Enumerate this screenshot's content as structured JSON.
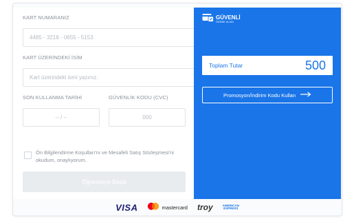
{
  "form": {
    "card_number_label": "KART NUMARANIZ",
    "card_number_placeholder": "4485 - 3218 - 0655 - 5153",
    "name_label": "KART ÜZERİNDEKİ İSİM",
    "name_placeholder": "Kart üzerindeki ismi yazınız.",
    "expiry_label": "SON KULLANMA TARİHİ",
    "expiry_placeholder": "-- / --",
    "cvc_label": "GÜVENLİK KODU (CVC)",
    "cvc_placeholder": "000",
    "consent_text": "Ön Bilgilendirme Koşulları'nı ve Mesafeli Satış Sözleşmesi'ni okudum, onaylıyorum.",
    "submit_label": "Öğrenmeye Başla"
  },
  "summary": {
    "brand_title": "GÜVENLİ",
    "brand_subtitle": "ÖDEME ALANI",
    "total_label": "Toplam Tutar",
    "total_amount": "500",
    "promo_label": "Promosyon/İndirim Kodu Kullan"
  },
  "footer": {
    "visa": "VISA",
    "mastercard": "mastercard",
    "troy": "troy",
    "amex_line1": "AMERICAN",
    "amex_line2": "EXPRESS"
  },
  "colors": {
    "accent": "#1a75e8",
    "button_disabled": "#e9ecef"
  },
  "icons": [
    "secure-card-icon",
    "arrow-right-icon",
    "mastercard-logo-icon"
  ]
}
